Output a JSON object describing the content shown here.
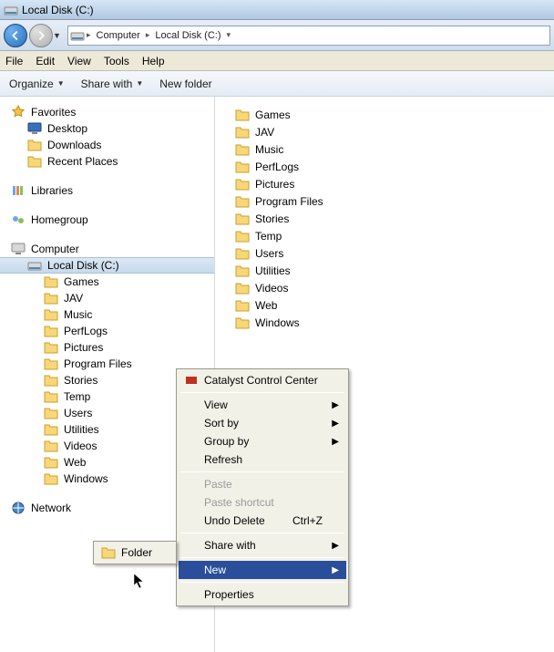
{
  "window": {
    "title": "Local Disk (C:)"
  },
  "breadcrumb": {
    "root_arrow": "▸",
    "seg1": "Computer",
    "seg2": "Local Disk (C:)"
  },
  "menubar": [
    "File",
    "Edit",
    "View",
    "Tools",
    "Help"
  ],
  "toolbar": {
    "organize": "Organize",
    "share": "Share with",
    "newfolder": "New folder"
  },
  "sidebar": {
    "favorites": {
      "label": "Favorites",
      "items": [
        "Desktop",
        "Downloads",
        "Recent Places"
      ]
    },
    "libraries": {
      "label": "Libraries"
    },
    "homegroup": {
      "label": "Homegroup"
    },
    "computer": {
      "label": "Computer",
      "drive": "Local Disk (C:)",
      "folders": [
        "Games",
        "JAV",
        "Music",
        "PerfLogs",
        "Pictures",
        "Program Files",
        "Stories",
        "Temp",
        "Users",
        "Utilities",
        "Videos",
        "Web",
        "Windows"
      ]
    },
    "network": {
      "label": "Network"
    }
  },
  "main_folders": [
    "Games",
    "JAV",
    "Music",
    "PerfLogs",
    "Pictures",
    "Program Files",
    "Stories",
    "Temp",
    "Users",
    "Utilities",
    "Videos",
    "Web",
    "Windows"
  ],
  "context_menu": {
    "ccc": "Catalyst Control Center",
    "view": "View",
    "sortby": "Sort by",
    "groupby": "Group by",
    "refresh": "Refresh",
    "paste": "Paste",
    "paste_shortcut": "Paste shortcut",
    "undo_delete": "Undo Delete",
    "undo_key": "Ctrl+Z",
    "sharewith": "Share with",
    "new": "New",
    "properties": "Properties"
  },
  "context_sub": {
    "folder": "Folder"
  }
}
